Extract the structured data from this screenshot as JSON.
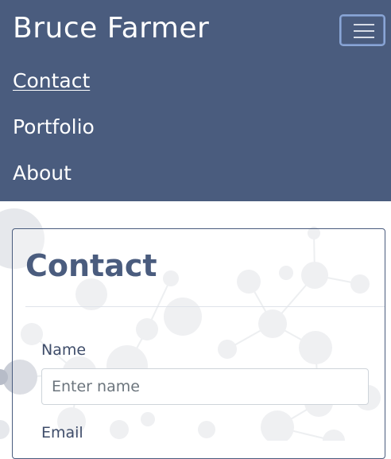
{
  "navbar": {
    "brand": "Bruce Farmer",
    "links": [
      {
        "label": "Contact",
        "active": true
      },
      {
        "label": "Portfolio",
        "active": false
      },
      {
        "label": "About",
        "active": false
      }
    ],
    "toggler_icon": "hamburger-icon",
    "background_color": "#4a5c7e"
  },
  "contact_card": {
    "title": "Contact",
    "fields": [
      {
        "label": "Name",
        "placeholder": "Enter name"
      },
      {
        "label": "Email"
      }
    ]
  }
}
